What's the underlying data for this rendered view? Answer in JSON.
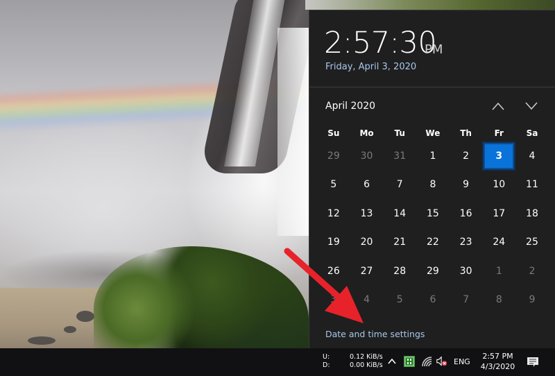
{
  "flyout": {
    "time": "2:57:30",
    "ampm": "PM",
    "date_long": "Friday, April 3, 2020",
    "month_label": "April 2020",
    "nav": {
      "prev_icon": "chevron-up-icon",
      "next_icon": "chevron-down-icon"
    },
    "weekdays": [
      "Su",
      "Mo",
      "Tu",
      "We",
      "Th",
      "Fr",
      "Sa"
    ],
    "weeks": [
      [
        {
          "d": "29",
          "muted": true
        },
        {
          "d": "30",
          "muted": true
        },
        {
          "d": "31",
          "muted": true
        },
        {
          "d": "1"
        },
        {
          "d": "2"
        },
        {
          "d": "3",
          "today": true
        },
        {
          "d": "4"
        }
      ],
      [
        {
          "d": "5"
        },
        {
          "d": "6"
        },
        {
          "d": "7"
        },
        {
          "d": "8"
        },
        {
          "d": "9"
        },
        {
          "d": "10"
        },
        {
          "d": "11"
        }
      ],
      [
        {
          "d": "12"
        },
        {
          "d": "13"
        },
        {
          "d": "14"
        },
        {
          "d": "15"
        },
        {
          "d": "16"
        },
        {
          "d": "17"
        },
        {
          "d": "18"
        }
      ],
      [
        {
          "d": "19"
        },
        {
          "d": "20"
        },
        {
          "d": "21"
        },
        {
          "d": "22"
        },
        {
          "d": "23"
        },
        {
          "d": "24"
        },
        {
          "d": "25"
        }
      ],
      [
        {
          "d": "26"
        },
        {
          "d": "27"
        },
        {
          "d": "28"
        },
        {
          "d": "29"
        },
        {
          "d": "30"
        },
        {
          "d": "1",
          "muted": true
        },
        {
          "d": "2",
          "muted": true
        }
      ],
      [
        {
          "d": "3",
          "muted": true
        },
        {
          "d": "4",
          "muted": true
        },
        {
          "d": "5",
          "muted": true
        },
        {
          "d": "6",
          "muted": true
        },
        {
          "d": "7",
          "muted": true
        },
        {
          "d": "8",
          "muted": true
        },
        {
          "d": "9",
          "muted": true
        }
      ]
    ],
    "settings_link": "Date and time settings"
  },
  "taskbar": {
    "net_upload_label": "U:",
    "net_download_label": "D:",
    "net_upload_value": "0.12 KiB/s",
    "net_download_value": "0.00 KiB/s",
    "tray_icons": [
      "chevron-up-icon",
      "green-app-icon",
      "wifi-icon",
      "speaker-muted-icon"
    ],
    "language": "ENG",
    "clock_time": "2:57 PM",
    "clock_date": "4/3/2020",
    "notification_icon": "action-center-icon"
  },
  "colors": {
    "accent": "#0a73d9",
    "link": "#a7c8ec",
    "flyout_bg": "#1f1f1f",
    "taskbar_bg": "#111113",
    "annotation_arrow": "#e8222a"
  }
}
